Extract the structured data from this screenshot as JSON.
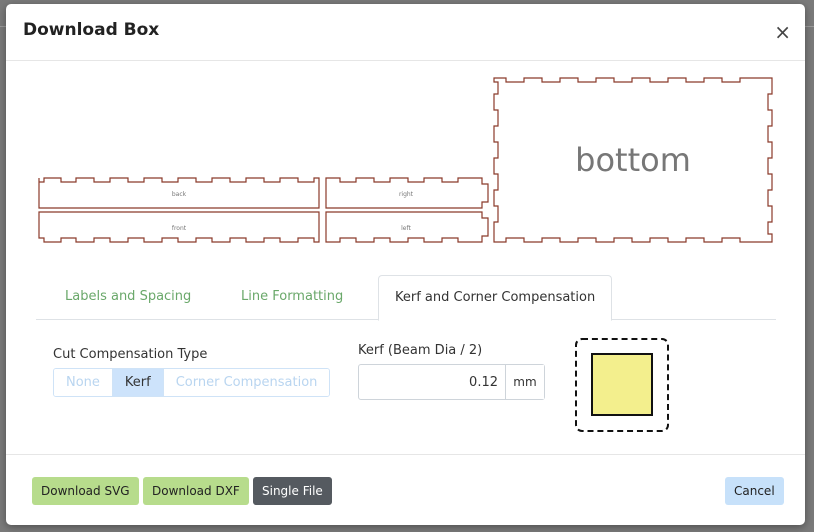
{
  "modal": {
    "title": "Download Box",
    "close_label": "×"
  },
  "preview": {
    "colors": {
      "outline": "#8b3a2a",
      "label": "#777777"
    },
    "panels": {
      "back": "back",
      "front": "front",
      "right": "right",
      "left": "left",
      "bottom": "bottom"
    }
  },
  "tabs": [
    {
      "label": "Labels and Spacing",
      "active": false
    },
    {
      "label": "Line Formatting",
      "active": false
    },
    {
      "label": "Kerf and Corner Compensation",
      "active": true
    }
  ],
  "compensation": {
    "label": "Cut Compensation Type",
    "options": [
      "None",
      "Kerf",
      "Corner Compensation"
    ],
    "selected": "Kerf"
  },
  "kerf": {
    "label": "Kerf (Beam Dia / 2)",
    "value": "0.12",
    "unit": "mm"
  },
  "preview_swatch": {
    "fill": "#f3ef8d"
  },
  "footer": {
    "download_svg": "Download SVG",
    "download_dxf": "Download DXF",
    "single_file": "Single File",
    "cancel": "Cancel"
  }
}
